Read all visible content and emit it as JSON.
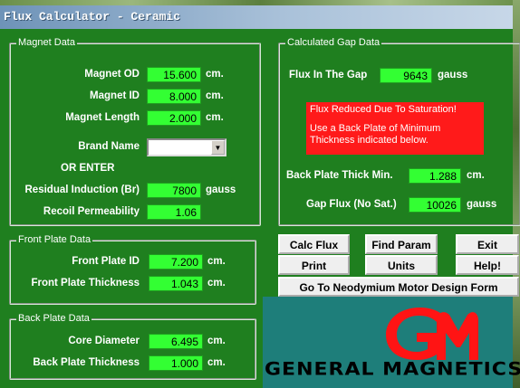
{
  "window": {
    "title": "Flux Calculator - Ceramic"
  },
  "magnet_data": {
    "legend": "Magnet Data",
    "od": {
      "label": "Magnet OD",
      "value": "15.600",
      "unit": "cm."
    },
    "id": {
      "label": "Magnet ID",
      "value": "8.000",
      "unit": "cm."
    },
    "length": {
      "label": "Magnet Length",
      "value": "2.000",
      "unit": "cm."
    },
    "brand": {
      "label": "Brand Name",
      "value": ""
    },
    "or_enter": "OR ENTER",
    "br": {
      "label": "Residual Induction (Br)",
      "value": "7800",
      "unit": "gauss"
    },
    "recoil": {
      "label": "Recoil Permeability",
      "value": "1.06"
    }
  },
  "gap_data": {
    "legend": "Calculated Gap Data",
    "flux": {
      "label": "Flux In The Gap",
      "value": "9643",
      "unit": "gauss"
    },
    "warning_line1": "Flux Reduced Due To Saturation!",
    "warning_line2": "Use a Back Plate of Minimum Thickness indicated below.",
    "back_min": {
      "label": "Back Plate Thick Min.",
      "value": "1.288",
      "unit": "cm."
    },
    "gap_flux": {
      "label": "Gap Flux (No Sat.)",
      "value": "10026",
      "unit": "gauss"
    }
  },
  "front_plate": {
    "legend": "Front Plate Data",
    "id": {
      "label": "Front Plate ID",
      "value": "7.200",
      "unit": "cm."
    },
    "thickness": {
      "label": "Front Plate Thickness",
      "value": "1.043",
      "unit": "cm."
    }
  },
  "back_plate": {
    "legend": "Back Plate Data",
    "core": {
      "label": "Core Diameter",
      "value": "6.495",
      "unit": "cm."
    },
    "thickness": {
      "label": "Back Plate Thickness",
      "value": "1.000",
      "unit": "cm."
    }
  },
  "buttons": {
    "calc_flux": "Calc Flux",
    "find_param": "Find Param",
    "exit": "Exit",
    "print": "Print",
    "units": "Units",
    "help": "Help!",
    "neodymium": "Go To Neodymium Motor Design Form"
  },
  "logo": {
    "text": "GENERAL MAGNETICS"
  },
  "colors": {
    "form_bg": "#1f7f1f",
    "field_bg": "#33ff33",
    "warning_bg": "#ff1a1a",
    "logo_bg": "#1e7e7a",
    "logo_red": "#ff1414"
  }
}
